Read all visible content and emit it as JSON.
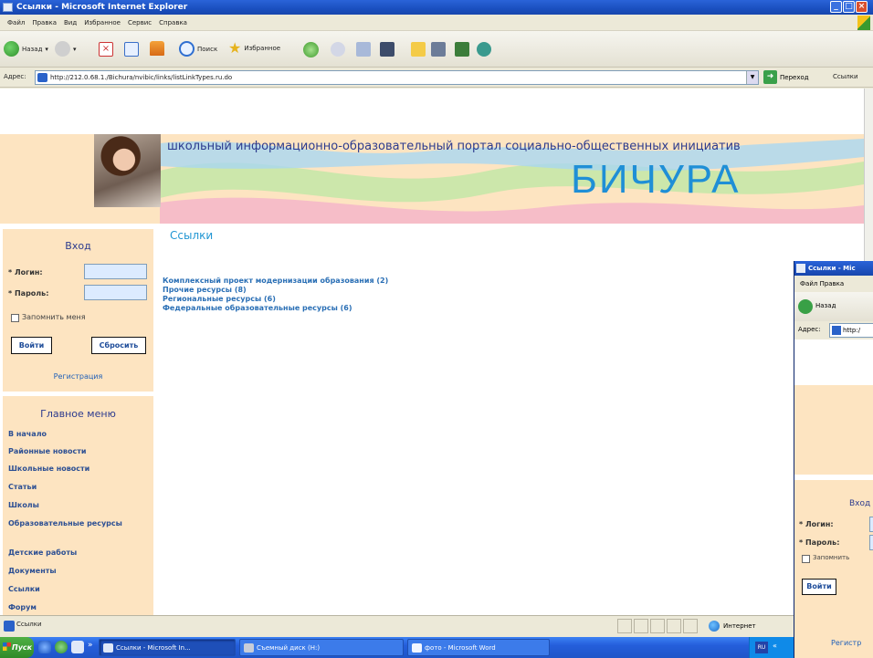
{
  "window": {
    "title": "Ссылки - Microsoft Internet Explorer",
    "controls": [
      "_",
      "□",
      "×"
    ]
  },
  "menubar": {
    "items": [
      "Файл",
      "Правка",
      "Вид",
      "Избранное",
      "Сервис",
      "Справка"
    ]
  },
  "toolbar": {
    "back_label": "Назад",
    "search_label": "Поиск",
    "favorites_label": "Избранное"
  },
  "addressbar": {
    "label": "Адрес:",
    "url": "http://212.0.68.1./Bichura/nvibic/links/listLinkTypes.ru.do",
    "go_label": "Переход",
    "links_label": "Ссылки"
  },
  "banner": {
    "tagline": "школьный информационно-образовательный портал социально-общественных инициатив",
    "logo_text": "БИЧУРА"
  },
  "login": {
    "title": "Вход",
    "login_label": "* Логин:",
    "password_label": "* Пароль:",
    "remember_label": "Запомнить меня",
    "submit_label": "Войти",
    "reset_label": "Сбросить",
    "register_label": "Регистрация"
  },
  "main_menu": {
    "title": "Главное меню",
    "items": [
      "В начало",
      "Районные новости",
      "Школьные новости",
      "Статьи",
      "Школы",
      "Образовательные ресурсы",
      "Детские работы",
      "Документы",
      "Ссылки",
      "Форум"
    ]
  },
  "content": {
    "heading": "Ссылки",
    "links": [
      "Комплексный проект модернизации образования (2)",
      "Прочие ресурсы (8)",
      "Региональные ресурсы (6)",
      "Федеральные образовательные ресурсы (6)"
    ]
  },
  "statusbar": {
    "text": "Ссылки",
    "zone": "Интернет"
  },
  "taskbar": {
    "start_label": "Пуск",
    "chevron": "»",
    "tasks": [
      "Ссылки - Microsoft In...",
      "Съемный диск (H:)",
      "фото - Microsoft Word"
    ],
    "tray_lang": "RU",
    "tray_chevron": "«"
  },
  "second_window": {
    "title": "Ссылки - Mic",
    "menubar": "Файл  Правка",
    "back_label": "Назад",
    "address_label": "Адрес:",
    "address_value": "http:/",
    "login_title": "Вход",
    "login_label": "* Логин:",
    "password_label": "* Пароль:",
    "remember_label": "Запомнить",
    "submit_label": "Войти",
    "register_label": "Регистр"
  },
  "colors": {
    "accent": "#2196d3",
    "panel_bg": "#fde4c1",
    "xp_blue": "#245edb",
    "link": "#2a6fb5"
  }
}
